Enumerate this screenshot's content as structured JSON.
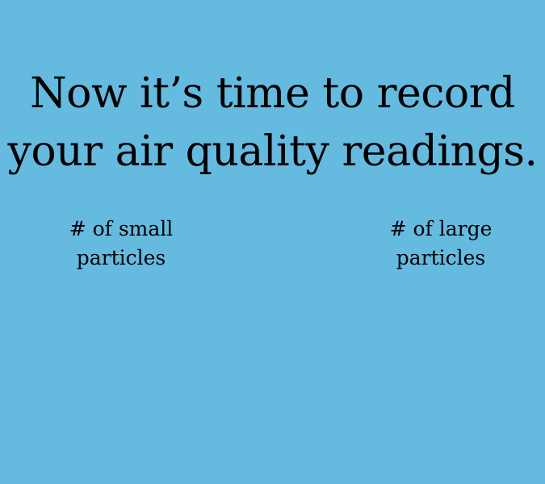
{
  "screen": {
    "background_color": "#65bae0",
    "headline": {
      "line1": "Now it’s time to record",
      "line2": "your air quality readings."
    },
    "small_particles": {
      "line1": "# of small",
      "line2": "particles"
    },
    "large_particles": {
      "line1": "# of large",
      "line2": "particles"
    }
  }
}
